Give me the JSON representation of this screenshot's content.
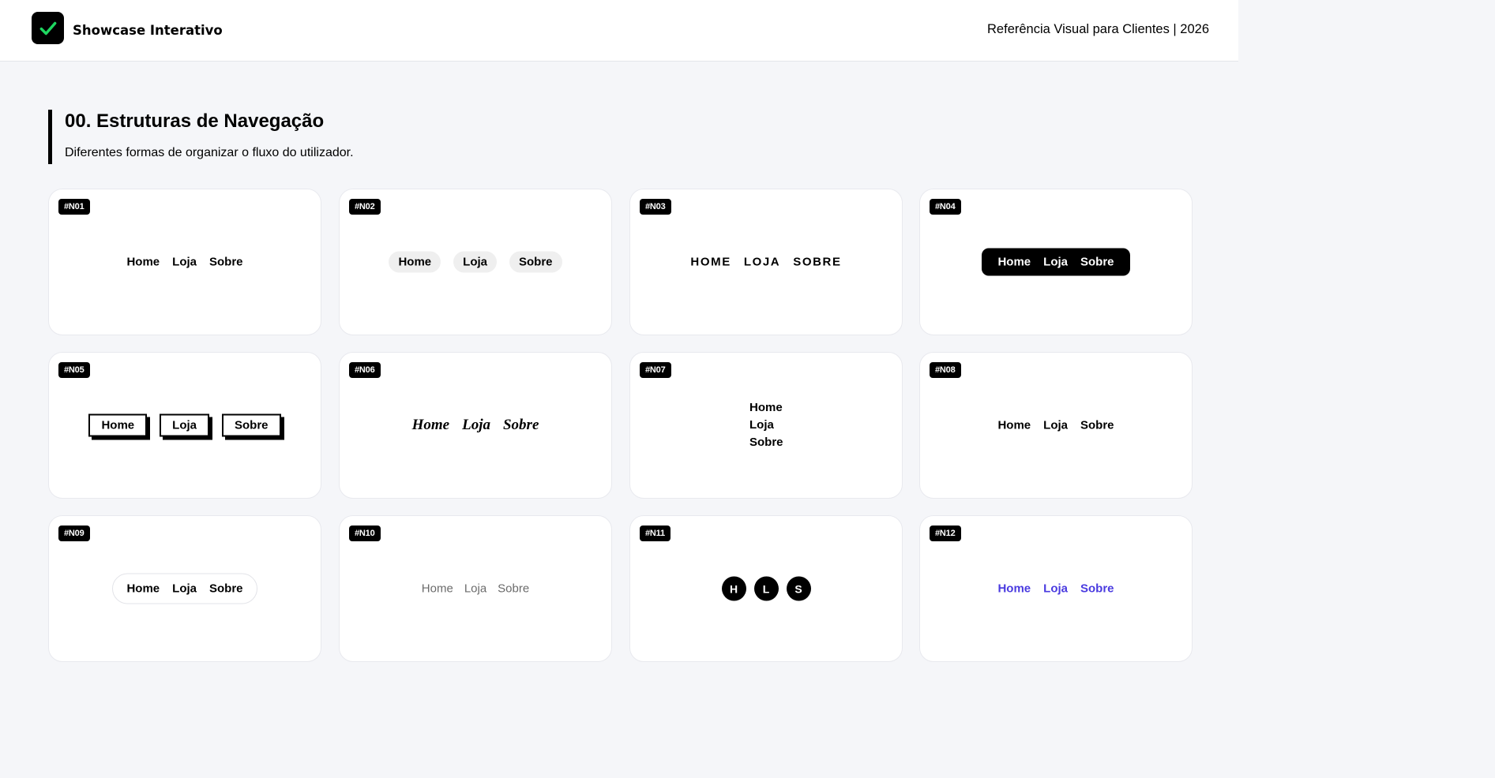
{
  "header": {
    "brand": "Showcase Interativo",
    "reference": "Referência Visual para Clientes | 2026",
    "logo_icon": "check-icon",
    "check_color": "#1ed760"
  },
  "section": {
    "title": "00. Estruturas de Navegação",
    "subtitle": "Diferentes formas de organizar o fluxo do utilizador."
  },
  "cards": [
    {
      "id": "#N01",
      "items": [
        "Home",
        "Loja",
        "Sobre"
      ]
    },
    {
      "id": "#N02",
      "items": [
        "Home",
        "Loja",
        "Sobre"
      ]
    },
    {
      "id": "#N03",
      "items": [
        "Home",
        "Loja",
        "Sobre"
      ]
    },
    {
      "id": "#N04",
      "items": [
        "Home",
        "Loja",
        "Sobre"
      ]
    },
    {
      "id": "#N05",
      "items": [
        "Home",
        "Loja",
        "Sobre"
      ]
    },
    {
      "id": "#N06",
      "items": [
        "Home",
        "Loja",
        "Sobre"
      ]
    },
    {
      "id": "#N07",
      "items": [
        "Home",
        "Loja",
        "Sobre"
      ]
    },
    {
      "id": "#N08",
      "items": [
        "Home",
        "Loja",
        "Sobre"
      ]
    },
    {
      "id": "#N09",
      "items": [
        "Home",
        "Loja",
        "Sobre"
      ]
    },
    {
      "id": "#N10",
      "items": [
        "Home",
        "Loja",
        "Sobre"
      ]
    },
    {
      "id": "#N11",
      "items": [
        "H",
        "L",
        "S"
      ]
    },
    {
      "id": "#N12",
      "items": [
        "Home",
        "Loja",
        "Sobre"
      ],
      "color": "#4a3be0"
    }
  ]
}
